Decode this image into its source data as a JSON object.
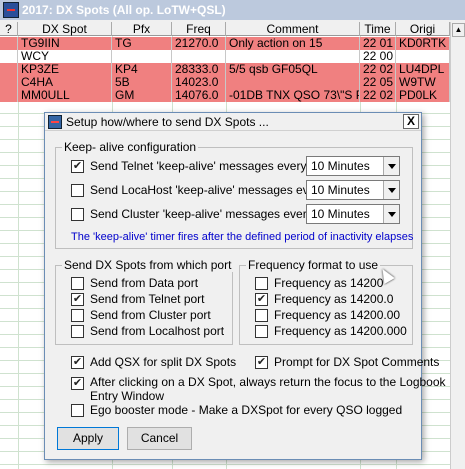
{
  "window": {
    "title": "2017: DX Spots (All op. LoTW+QSL)"
  },
  "columns": [
    "?",
    "DX Spot",
    "Pfx",
    "Freq",
    "Comment",
    "Time",
    "Origi"
  ],
  "rows": [
    {
      "spot": "TG9IIN",
      "pfx": "TG",
      "freq": "21270.0",
      "comment": "Only action on 15",
      "time": "22 01",
      "orig": "KD0RTK",
      "color": "#f08080"
    },
    {
      "spot": "WCY",
      "pfx": "",
      "freq": "",
      "comment": "",
      "time": "22 00",
      "orig": "",
      "color": "#ffffff"
    },
    {
      "spot": "KP3ZE",
      "pfx": "KP4",
      "freq": "28333.0",
      "comment": "5/5 qsb GF05QL",
      "time": "22 02",
      "orig": "LU4DPL",
      "color": "#f08080"
    },
    {
      "spot": "C4HA",
      "pfx": "5B",
      "freq": "14023.0",
      "comment": "",
      "time": "22 05",
      "orig": "W9TW",
      "color": "#f08080"
    },
    {
      "spot": "MM0ULL",
      "pfx": "GM",
      "freq": "14076.0",
      "comment": "-01DB TNX QSO 73\\\"S P",
      "time": "22 02",
      "orig": "PD0LK",
      "color": "#f08080"
    }
  ],
  "dialog": {
    "title": "Setup how/where to send DX Spots ...",
    "close": "X",
    "keepalive": {
      "label": "Keep- alive configuration",
      "items": [
        {
          "label": "Send Telnet 'keep-alive' messages every",
          "checked": true,
          "value": "10 Minutes"
        },
        {
          "label": "Send LocaHost 'keep-alive' messages every",
          "checked": false,
          "value": "10 Minutes"
        },
        {
          "label": "Send Cluster 'keep-alive' messages every",
          "checked": false,
          "value": "10 Minutes"
        }
      ],
      "note": "The 'keep-alive' timer fires after the defined period of inactivity elapses"
    },
    "port": {
      "label": "Send DX Spots from which port",
      "items": [
        {
          "label": "Send from Data port",
          "checked": false
        },
        {
          "label": "Send from Telnet port",
          "checked": true
        },
        {
          "label": "Send from Cluster port",
          "checked": false
        },
        {
          "label": "Send from Localhost port",
          "checked": false
        }
      ]
    },
    "freq": {
      "label": "Frequency format to use",
      "items": [
        {
          "label": "Frequency as 14200",
          "checked": false
        },
        {
          "label": "Frequency as 14200.0",
          "checked": true
        },
        {
          "label": "Frequency as 14200.00",
          "checked": false
        },
        {
          "label": "Frequency as 14200.000",
          "checked": false
        }
      ]
    },
    "opts": {
      "qsx": {
        "label": "Add QSX for split DX Spots",
        "checked": true
      },
      "prompt": {
        "label": "Prompt for DX Spot Comments",
        "checked": true
      },
      "focus1": "After clicking on a DX Spot, always return the focus to the Logbook",
      "focus2": "Entry Window",
      "focus_checked": true,
      "ego": {
        "label": "Ego booster mode - Make a DXSpot for every QSO logged",
        "checked": false
      }
    },
    "apply": "Apply",
    "cancel": "Cancel"
  }
}
